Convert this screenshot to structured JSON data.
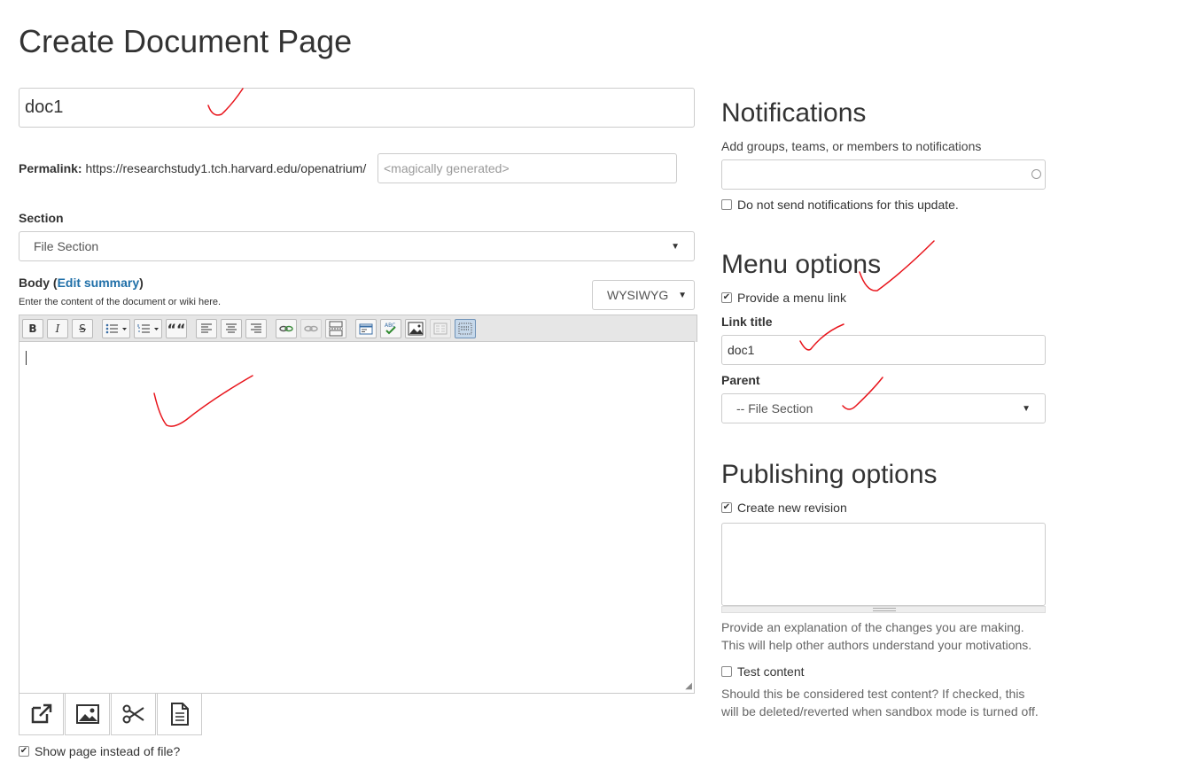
{
  "page_title": "Create Document Page",
  "title_field": {
    "value": "doc1"
  },
  "permalink": {
    "label": "Permalink:",
    "base": "https://researchstudy1.tch.harvard.edu/openatrium/",
    "placeholder": "<magically generated>"
  },
  "section": {
    "label": "Section",
    "selected": "File Section"
  },
  "body": {
    "label": "Body",
    "edit_summary": "Edit summary",
    "help": "Enter the content of the document or wiki here.",
    "format_selected": "WYSIWYG"
  },
  "toolbar": {
    "bold": "B",
    "italic": "I",
    "strike": "S",
    "blockquote": "““"
  },
  "show_page": {
    "label": "Show page instead of file?",
    "checked": true
  },
  "notifications": {
    "heading": "Notifications",
    "help": "Add groups, teams, or members to notifications",
    "no_notify_label": "Do not send notifications for this update."
  },
  "menu_options": {
    "heading": "Menu options",
    "provide_link_label": "Provide a menu link",
    "link_title_label": "Link title",
    "link_title_value": "doc1",
    "parent_label": "Parent",
    "parent_selected": "-- File Section"
  },
  "publishing": {
    "heading": "Publishing options",
    "new_revision_label": "Create new revision",
    "revision_help_1": "Provide an explanation of the changes you are making.",
    "revision_help_2": "This will help other authors understand your motivations.",
    "test_content_label": "Test content",
    "test_help_1": "Should this be considered test content? If checked, this",
    "test_help_2": "will be deleted/reverted when sandbox mode is turned off."
  },
  "annotation_color": "#e8141b",
  "icons": [
    "bold-icon",
    "italic-icon",
    "strikethrough-icon",
    "bullet-list-icon",
    "numbered-list-icon",
    "blockquote-icon",
    "align-left-icon",
    "align-center-icon",
    "align-right-icon",
    "link-icon",
    "unlink-icon",
    "page-break-icon",
    "source-icon",
    "spellcheck-icon",
    "image-icon",
    "template-icon",
    "show-blocks-icon",
    "external-link-icon",
    "media-icon",
    "cut-icon",
    "document-icon"
  ]
}
